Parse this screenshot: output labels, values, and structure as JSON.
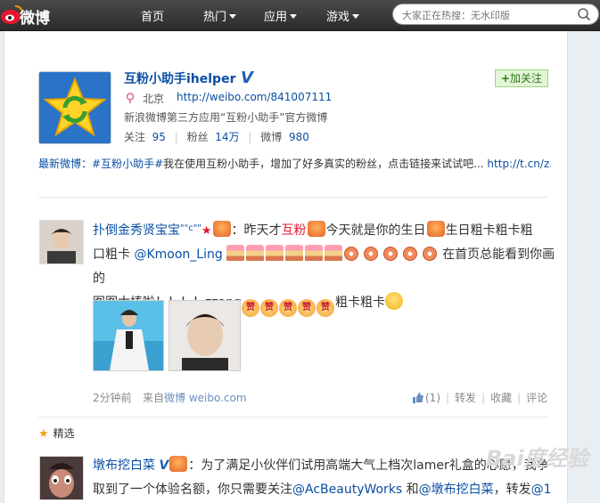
{
  "nav": {
    "logo_text": "微博",
    "items": [
      {
        "label": "首页",
        "has_caret": false
      },
      {
        "label": "热门",
        "has_caret": true
      },
      {
        "label": "应用",
        "has_caret": true
      },
      {
        "label": "游戏",
        "has_caret": true
      }
    ],
    "search_placeholder": "大家正在热搜：无水印版"
  },
  "profile": {
    "name": "互粉小助手ihelper",
    "verified_badge": "V",
    "follow_label": "加关注",
    "location": "北京",
    "url": "http://weibo.com/841007111",
    "description": "新浪微博第三方应用“互粉小助手”官方微博",
    "stats": [
      {
        "label": "关注",
        "value": "95"
      },
      {
        "label": "粉丝",
        "value": "14万"
      },
      {
        "label": "微博",
        "value": "980"
      }
    ],
    "latest_label": "最新微博：",
    "latest_tag": "#互粉小助手#",
    "latest_text": "我在使用互粉小助手，增加了好多真实的粉丝，点击链接来试试吧...",
    "latest_link": "http://t.cn/z..."
  },
  "post1": {
    "author": "扑倒金秀贤宝宝",
    "author_suffix": "\"\"c\"\"",
    "line1_a": "：昨天才",
    "line1_highlight": "互粉",
    "line1_b": "今天就是你的生日",
    "line1_c": "生日粗卡粗卡粗",
    "line2_a": "口粗卡",
    "mention": "@Kmoon_Ling",
    "line2_b": "在首页总能看到你画的",
    "line3_a": "图图太棒啦！！！！zzang",
    "line3_b": "粗卡粗卡",
    "zan_char": "赞",
    "time": "2分钟前",
    "source_prefix": "来自",
    "source": "微博 weibo.com",
    "like_count": "(1)",
    "repost": "转发",
    "favorite": "收藏",
    "comment": "评论"
  },
  "featured_label": "精选",
  "post2": {
    "author": "墩布挖白菜",
    "verified_badge": "V",
    "text_a": "：为了满足小伙伴们试用高端大气上档次lamer礼盒的心愿，我争",
    "text_b": "取到了一个体验名额，你只需要关注",
    "mention1": "@AcBeautyWorks",
    "text_c": "和",
    "mention2": "@墩布挖白菜",
    "text_d": "，转发",
    "text_e": "@1"
  },
  "watermark_text": "Bai度经验",
  "colors": {
    "link": "#0a4fa3",
    "accent_orange": "#f3a01c",
    "follow_green": "#2f7a17"
  }
}
